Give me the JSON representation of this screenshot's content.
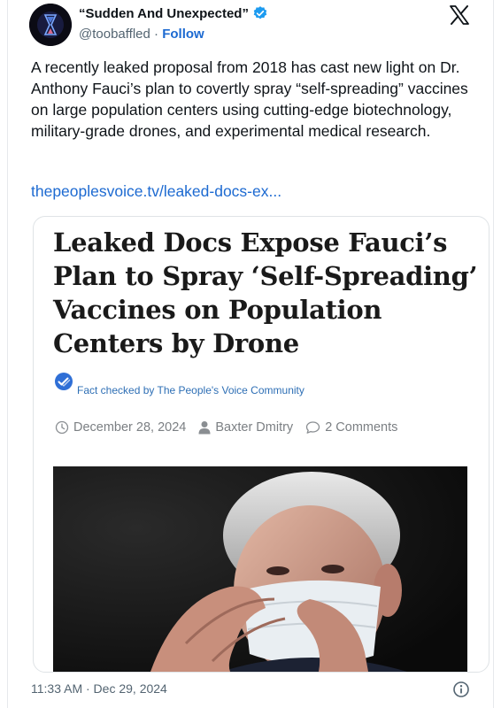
{
  "tweet": {
    "display_name": "“Sudden And Unexpected”",
    "handle": "@toobaffled",
    "separator": " · ",
    "follow_label": "Follow",
    "text": "A recently leaked proposal from 2018 has cast new light on Dr. Anthony Fauci’s plan to covertly spray “self-spreading” vaccines on large population centers using cutting-edge biotechnology, military-grade drones, and experimental medical research.",
    "link_text": "thepeoplesvoice.tv/leaked-docs-ex...",
    "timestamp": "11:33 AM · Dec 29, 2024"
  },
  "article": {
    "headline": "Leaked Docs Expose Fauci’s Plan to Spray ‘Self-Spreading’ Vaccines on Population Centers by Drone",
    "factcheck": "Fact checked by The People's Voice Community",
    "date": "December 28, 2024",
    "author": "Baxter Dmitry",
    "comments": "2 Comments"
  },
  "icons": {
    "verified": "verified-badge-icon",
    "x_logo": "x-logo-icon",
    "info": "info-icon",
    "clock": "clock-icon",
    "user": "user-icon",
    "comment": "comment-bubble-icon",
    "factcheck": "factcheck-checkmark-icon"
  },
  "colors": {
    "link": "#1d6ad1",
    "verified": "#1d9bf0",
    "secondary_text": "#536471",
    "factcheck_text": "#2e6fb5"
  }
}
